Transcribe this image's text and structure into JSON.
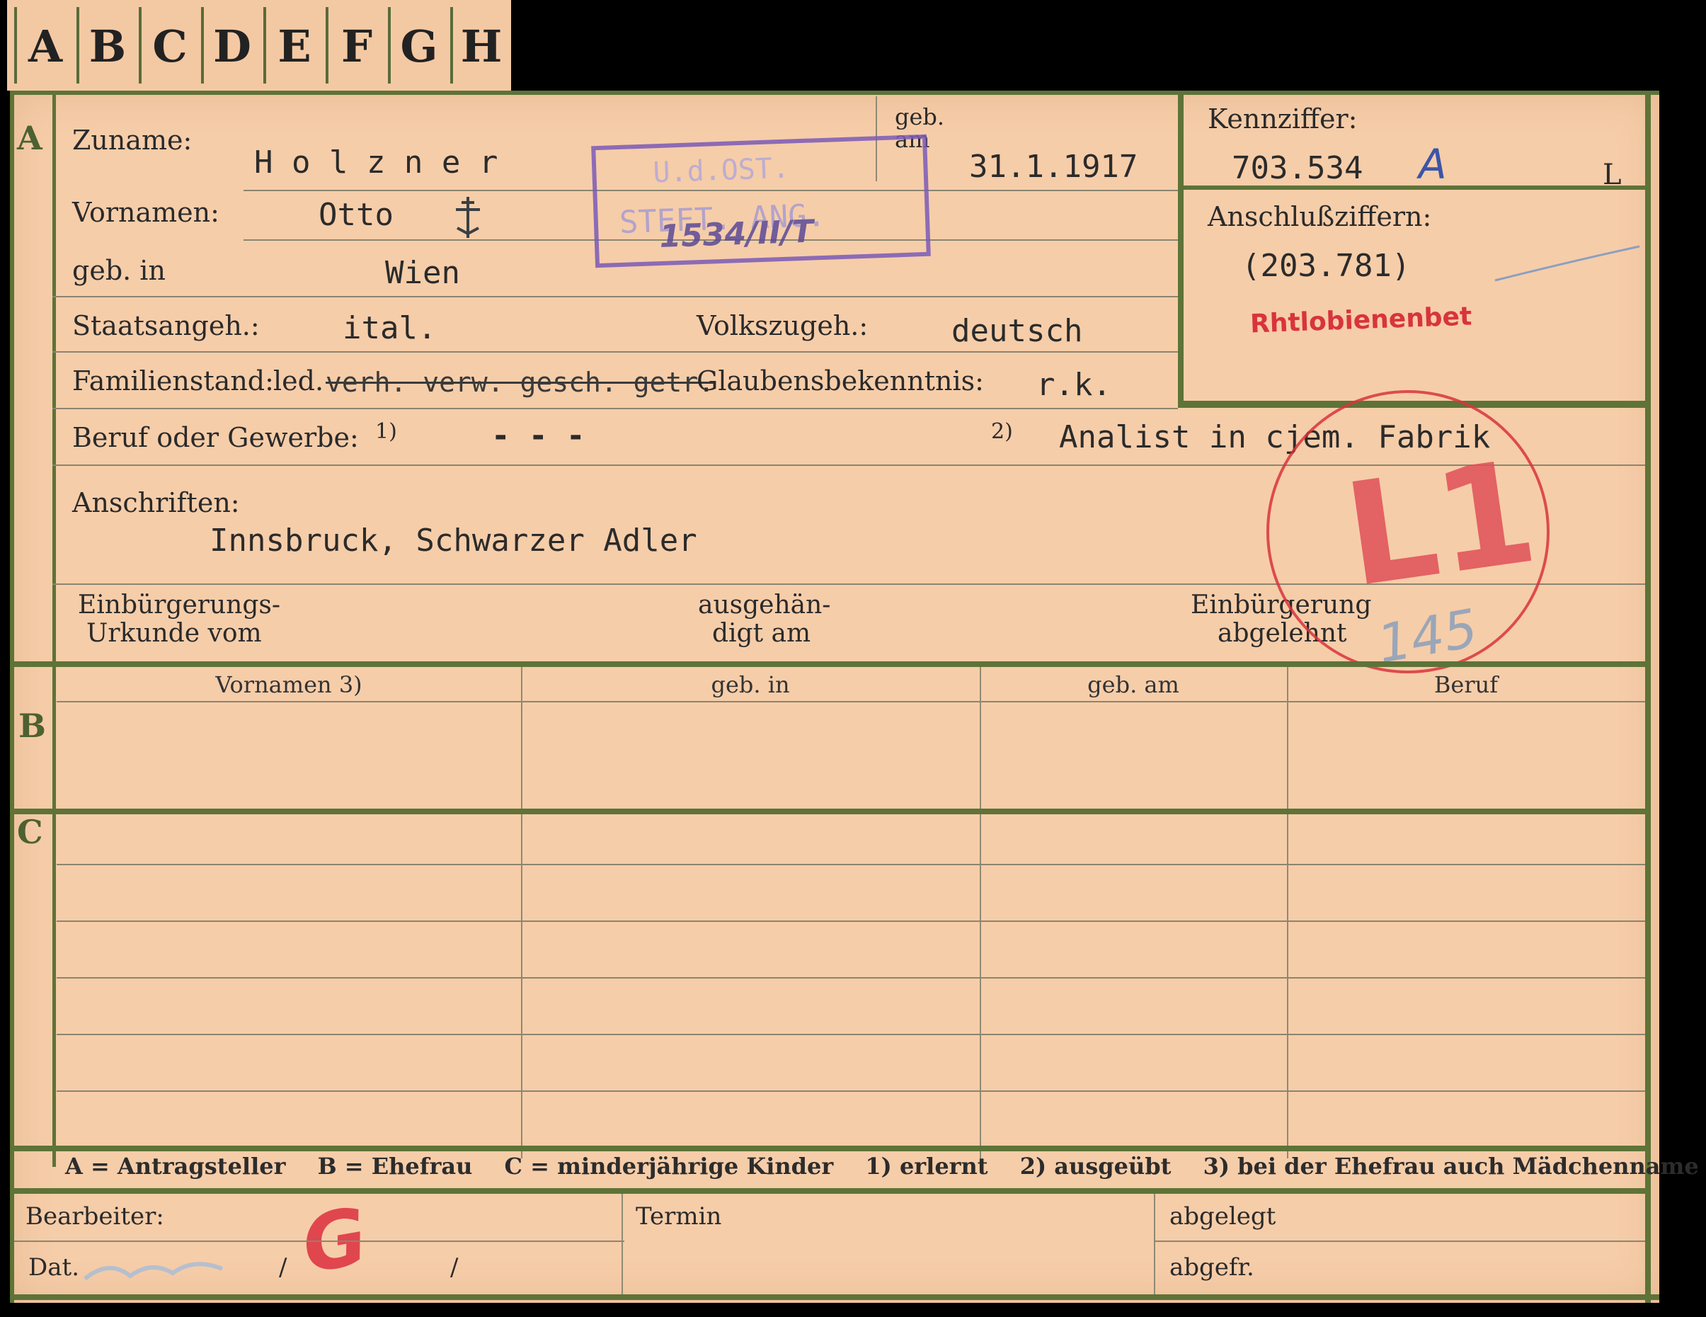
{
  "tabs": [
    "A",
    "B",
    "C",
    "D",
    "E",
    "F",
    "G",
    "H"
  ],
  "sections": {
    "a": "A",
    "b": "B",
    "c": "C"
  },
  "fields": {
    "zuname_label": "Zuname:",
    "zuname_value": "H o l z n e r",
    "geb_am_label_1": "geb.",
    "geb_am_label_2": "am",
    "geb_am_value": "31.1.1917",
    "vornamen_label": "Vornamen:",
    "vornamen_value": "Otto",
    "geb_in_label": "geb. in",
    "geb_in_value": "Wien",
    "staatsangeh_label": "Staatsangeh.:",
    "staatsangeh_value": "ital.",
    "volkszugeh_label": "Volkszugeh.:",
    "volkszugeh_value": "deutsch",
    "familienstand_label": "Familienstand:",
    "familienstand_value": "led.",
    "familienstand_struck": "verh. verw. gesch. getr.",
    "glaubens_label": "Glaubensbekenntnis:",
    "glaubens_value": "r.k.",
    "beruf_label": "Beruf oder Gewerbe:",
    "beruf_note1": "1)",
    "beruf_value1": "- - -",
    "beruf_note2": "2)",
    "beruf_value2": "Analist in cjem. Fabrik",
    "anschriften_label": "Anschriften:",
    "anschriften_value": "Innsbruck, Schwarzer Adler",
    "einb_urkunde_1": "Einbürgerungs-",
    "einb_urkunde_2": "Urkunde vom",
    "ausgehaen_1": "ausgehän-",
    "ausgehaen_2": "digt am",
    "einb_abgelehnt_1": "Einbürgerung",
    "einb_abgelehnt_2": "abgelehnt"
  },
  "kennziffer": {
    "label": "Kennziffer:",
    "value": "703.534",
    "hand": "A",
    "suffix": "L",
    "anschluss_label": "Anschlußziffern:",
    "anschluss_value": "(203.781)",
    "red_stamp": "Rhtlobienenbet"
  },
  "stamps": {
    "violet_line1": "U.d.OST.",
    "violet_line2": "STEFT. ANG.",
    "violet_hand": "1534/II/T",
    "red_circle_text": "L1",
    "red_number": "145"
  },
  "table_b": {
    "headers": [
      "Vornamen 3)",
      "geb. in",
      "geb. am",
      "Beruf"
    ]
  },
  "legend": {
    "a": "A = Antragsteller",
    "b": "B = Ehefrau",
    "c": "C = minderjährige Kinder",
    "n1": "1) erlernt",
    "n2": "2) ausgeübt",
    "n3": "3) bei der Ehefrau auch Mädchenname"
  },
  "footer": {
    "bearbeiter_label": "Bearbeiter:",
    "bearbeiter_initial": "G",
    "dat_label": "Dat.",
    "slash": "/",
    "termin_label": "Termin",
    "abgelegt_label": "abgelegt",
    "abgefr_label": "abgefr."
  },
  "colors": {
    "frame_green": "#5e7338",
    "card": "#f6cda9",
    "stamp_red": "#d8343c",
    "stamp_violet": "#7a5ab8"
  }
}
